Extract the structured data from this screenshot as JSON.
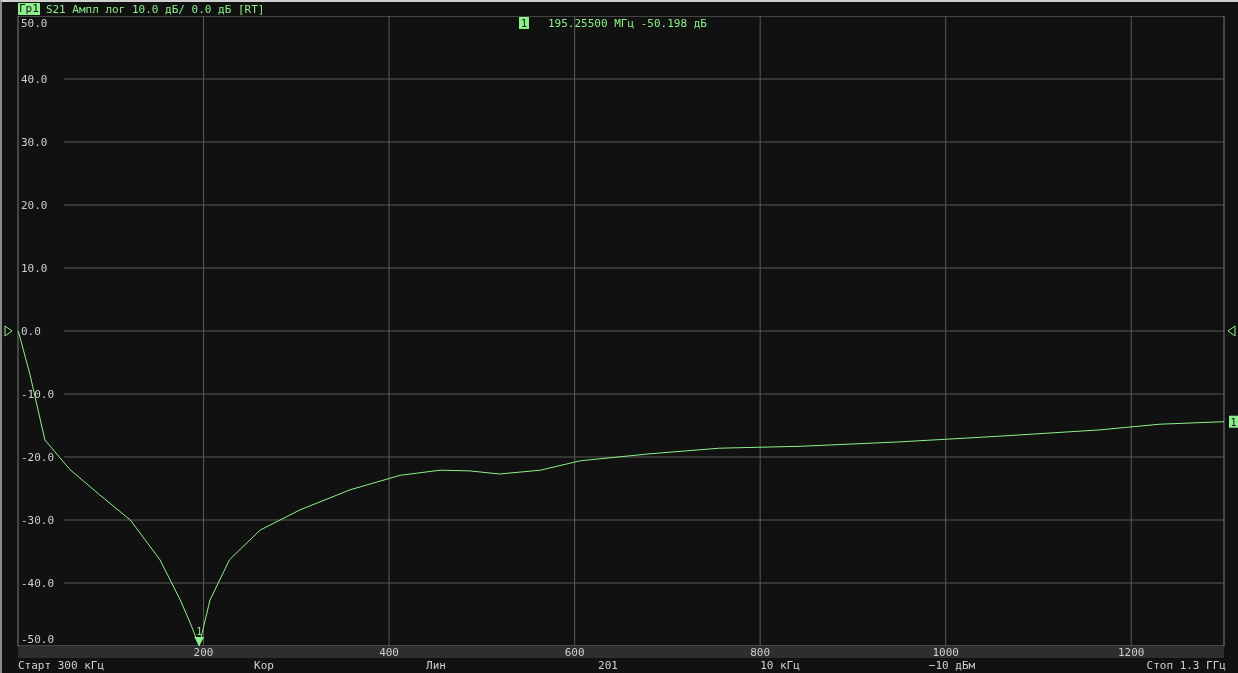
{
  "header": {
    "trace_badge": "Гр1",
    "trace_info": "S21 Ампл лог 10.0 дБ/ 0.0 дБ [RT]"
  },
  "plot": {
    "marker_readout": {
      "label": "1",
      "frequency": "195.25500 МГц",
      "value": "-50.198 дБ"
    },
    "trace_end_label": "1",
    "chart_data": {
      "type": "line",
      "grid": true,
      "xlim": [
        0,
        1300
      ],
      "ylim": [
        -50,
        50
      ],
      "xticks": [
        200,
        400,
        600,
        800,
        1000,
        1200
      ],
      "yticks": [
        {
          "value": 50,
          "label": "50.0"
        },
        {
          "value": 40,
          "label": "40.0"
        },
        {
          "value": 30,
          "label": "30.0"
        },
        {
          "value": 20,
          "label": "20.0"
        },
        {
          "value": 10,
          "label": "10.0"
        },
        {
          "value": 0,
          "label": "0.0"
        },
        {
          "value": -10,
          "label": "-10.0"
        },
        {
          "value": -20,
          "label": "-20.0"
        },
        {
          "value": -30,
          "label": "-30.0"
        },
        {
          "value": -40,
          "label": "-40.0"
        },
        {
          "value": -50,
          "label": "-50.0"
        }
      ],
      "x": [
        0.3,
        13,
        29,
        56,
        88,
        121,
        153,
        175,
        186,
        195.3,
        200,
        207,
        228,
        261,
        304,
        358,
        412,
        455,
        487,
        519,
        563,
        606,
        681,
        756,
        843,
        950,
        1058,
        1166,
        1231,
        1300
      ],
      "series": [
        {
          "color": "#8cf08c",
          "values": [
            0,
            -7,
            -17.3,
            -22,
            -26,
            -30,
            -36.3,
            -42.7,
            -46.5,
            -50,
            -47,
            -42.7,
            -36.3,
            -31.6,
            -28.4,
            -25.2,
            -22.9,
            -22.1,
            -22.2,
            -22.7,
            -22.1,
            -20.6,
            -19.5,
            -18.6,
            -18.3,
            -17.6,
            -16.7,
            -15.7,
            -14.8,
            -14.4
          ]
        }
      ],
      "annotations": [
        {
          "x": 195.3,
          "y": -50,
          "text": "1"
        }
      ]
    }
  },
  "status_bar": [
    "Старт 300 кГц",
    "Кор",
    "Лин",
    "201",
    "10 кГц",
    "−10 дБм",
    "Стоп 1.3 ГГц"
  ]
}
